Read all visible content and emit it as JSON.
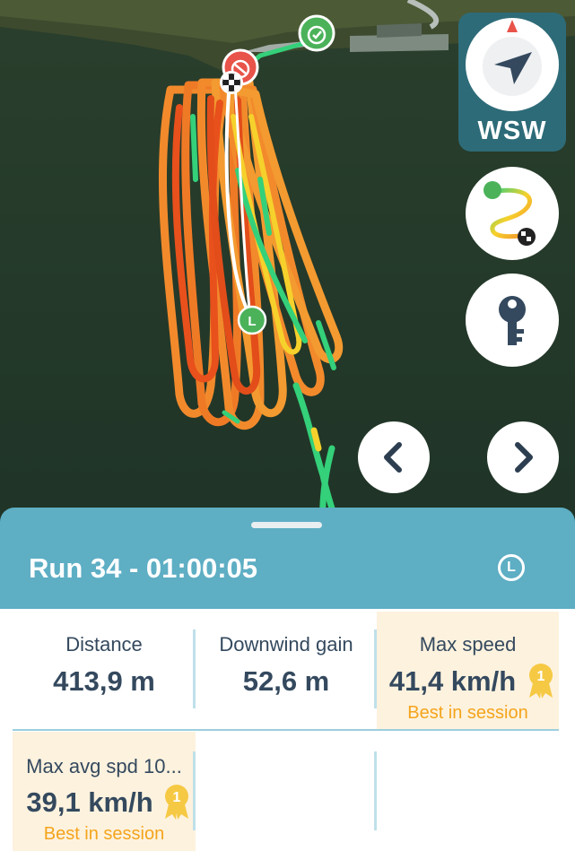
{
  "map": {
    "start_icon": "stopwatch-start-icon",
    "end_icon": "stopwatch-stop-icon",
    "finish_icon": "checkered-flag-icon",
    "longest_marker": "L",
    "colors": {
      "water": "#233a2b",
      "fast": "#e8501c",
      "mid": "#f28a2c",
      "slow": "#34d07a",
      "accent": "#5eaec4"
    }
  },
  "compass": {
    "direction": "WSW",
    "icon": "navigation-arrow-icon"
  },
  "buttons": {
    "track": "track-route-icon",
    "key": "key-icon",
    "prev": "chevron-left-icon",
    "next": "chevron-right-icon"
  },
  "run": {
    "title": "Run 34 - 01:00:05",
    "badge": "L"
  },
  "stats": {
    "distance": {
      "label": "Distance",
      "value": "413,9 m"
    },
    "downwind": {
      "label": "Downwind gain",
      "value": "52,6 m"
    },
    "max_speed": {
      "label": "Max speed",
      "value": "41,4 km/h",
      "note": "Best in session",
      "medal": "1"
    },
    "max_avg": {
      "label": "Max avg spd 10...",
      "value": "39,1 km/h",
      "note": "Best in session",
      "medal": "1"
    }
  }
}
